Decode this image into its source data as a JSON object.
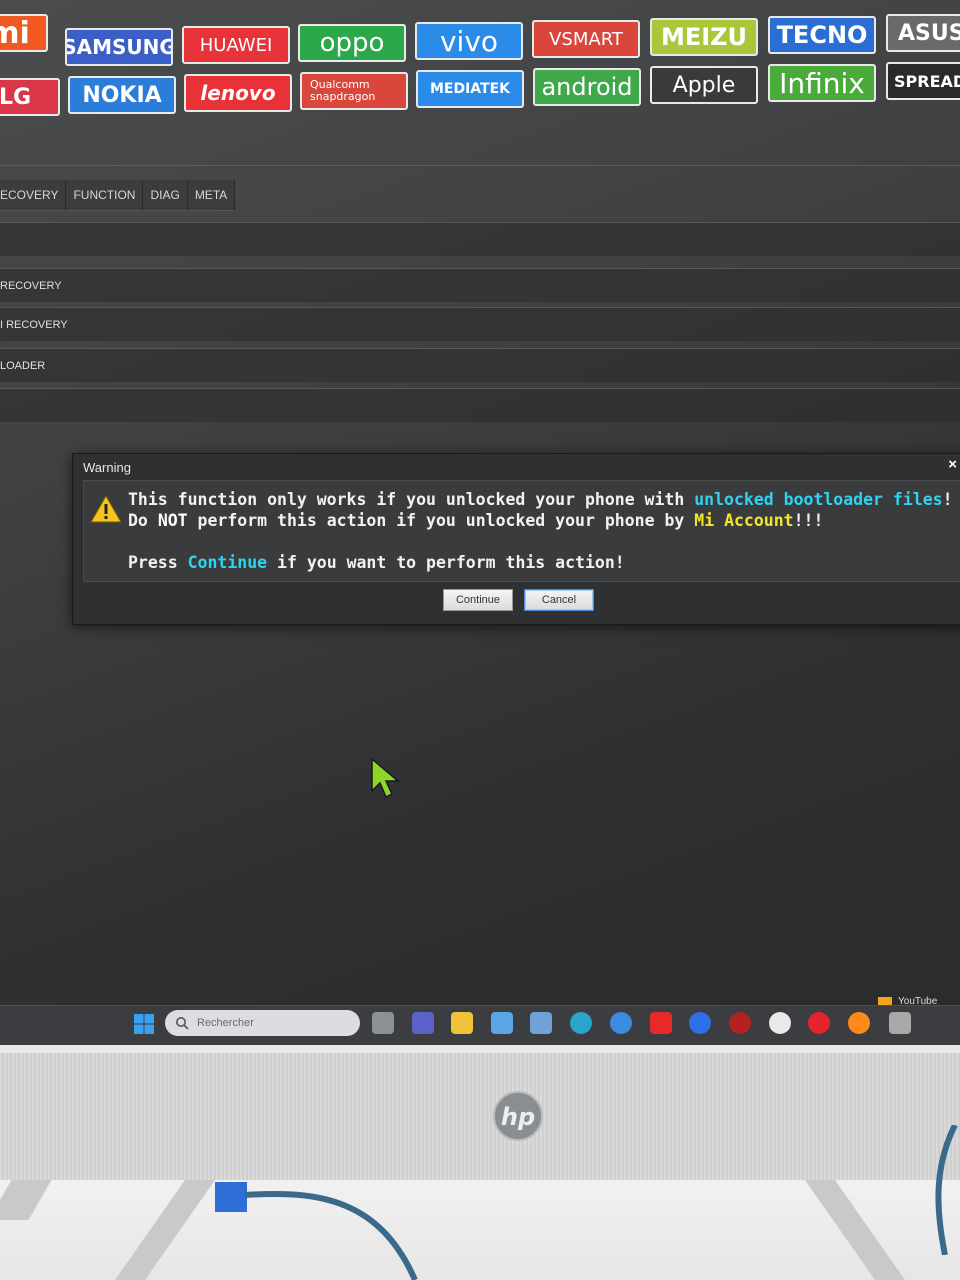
{
  "brands": {
    "row1": [
      {
        "label": "mi",
        "bg": "#f05a22"
      },
      {
        "label": "SAMSUNG",
        "bg": "#3b5fc7"
      },
      {
        "label": "HUAWEI",
        "bg": "#e8333a"
      },
      {
        "label": "oppo",
        "bg": "#2aa84a"
      },
      {
        "label": "vivo",
        "bg": "#2a8be8"
      },
      {
        "label": "VSMART",
        "bg": "#d9473c"
      },
      {
        "label": "MEIZU",
        "bg": "#a8c83a"
      },
      {
        "label": "TECNO",
        "bg": "#2a6ed4"
      },
      {
        "label": "ASUS",
        "bg": "#6a6a6a"
      }
    ],
    "row2": [
      {
        "label": "LG",
        "bg": "#d9364a"
      },
      {
        "label": "NOKIA",
        "bg": "#2a7ed9"
      },
      {
        "label": "lenovo",
        "bg": "#e83238"
      },
      {
        "label": "Qualcomm\nsnapdragon",
        "bg": "#d9473c"
      },
      {
        "label": "MEDIATEK",
        "bg": "#2a8be8"
      },
      {
        "label": "android",
        "bg": "#3ea84a"
      },
      {
        "label": "Apple",
        "bg": "#3a3a3a"
      },
      {
        "label": "Infinix",
        "bg": "#4aaa3a"
      },
      {
        "label": "SPREADTR",
        "bg": "#2a2a2a"
      }
    ]
  },
  "tabs": [
    "ECOVERY",
    "FUNCTION",
    "DIAG",
    "META"
  ],
  "rows": [
    "RECOVERY",
    "I RECOVERY",
    "LOADER"
  ],
  "dialog": {
    "title": "Warning",
    "close": "×",
    "line1_a": "This function only works if you unlocked your phone with ",
    "line1_b": "unlocked bootloader files",
    "line1_c": "!",
    "line2_a": "Do ",
    "line2_b": "NOT",
    "line2_c": " perform this action if you unlocked your phone by ",
    "line2_d": "Mi Account",
    "line2_e": "!!!",
    "line3_a": "Press ",
    "line3_b": "Continue",
    "line3_c": " if you want to perform this action!",
    "continue_label": "Continue",
    "cancel_label": "Cancel"
  },
  "taskbar": {
    "search_placeholder": "Rechercher",
    "notification": "YouTube",
    "icons": [
      "task-view-icon",
      "teams-icon",
      "file-explorer-icon",
      "mylp-icon",
      "store-icon",
      "edge-icon",
      "chrome-icon",
      "youtube-icon",
      "facebook-icon",
      "opera-icon",
      "itunes-icon",
      "opera-gx-icon",
      "firefox-icon",
      "tool-icon"
    ]
  },
  "monitor": {
    "brand": "hp"
  }
}
